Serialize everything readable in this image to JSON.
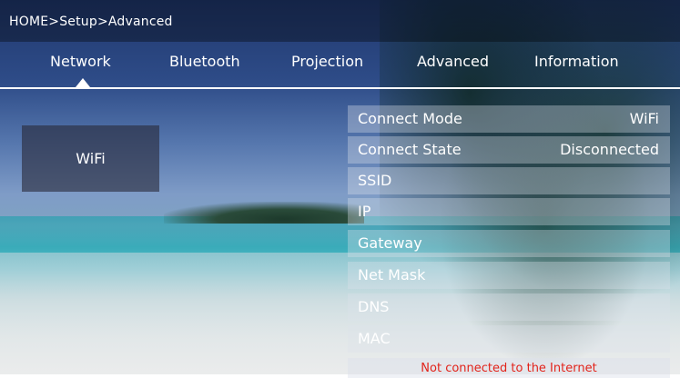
{
  "breadcrumb": "HOME>Setup>Advanced",
  "tabs": [
    {
      "label": "Network"
    },
    {
      "label": "Bluetooth"
    },
    {
      "label": "Projection"
    },
    {
      "label": "Advanced"
    },
    {
      "label": "Information"
    }
  ],
  "selected_tab": "Network",
  "connection_type": "WiFi",
  "network_info": [
    {
      "label": "Connect Mode",
      "value": "WiFi"
    },
    {
      "label": "Connect State",
      "value": "Disconnected"
    },
    {
      "label": "SSID",
      "value": ""
    },
    {
      "label": "IP",
      "value": ""
    },
    {
      "label": "Gateway",
      "value": ""
    },
    {
      "label": "Net Mask",
      "value": ""
    },
    {
      "label": "DNS",
      "value": ""
    },
    {
      "label": "MAC",
      "value": ""
    }
  ],
  "status_message": "Not connected to the Internet",
  "colors": {
    "status_error": "#e2231a",
    "accent": "#ffffff"
  }
}
